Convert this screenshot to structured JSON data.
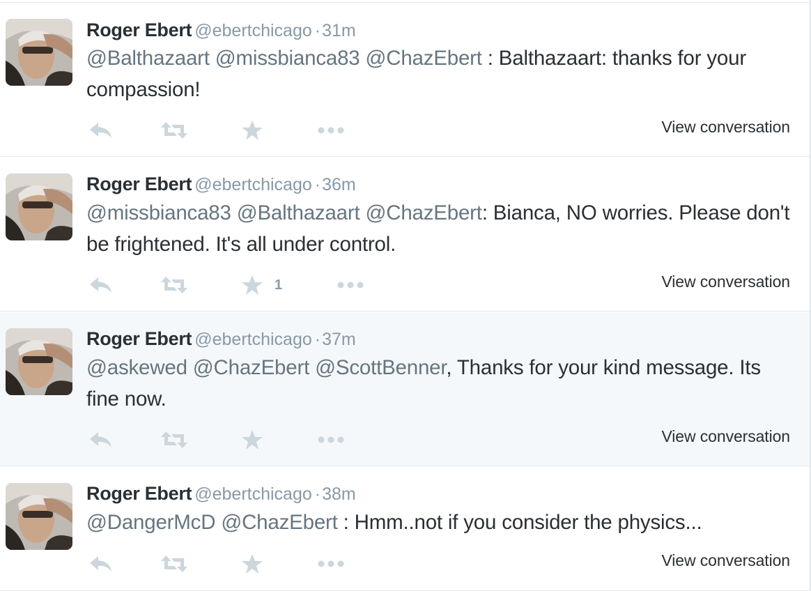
{
  "actions_labels": {
    "view_conversation": "View conversation"
  },
  "tweets": [
    {
      "fullname": "Roger Ebert",
      "username": "@ebertchicago",
      "dot": "·",
      "time": "31m",
      "mentions": "@Balthazaart @missbianca83 @ChazEbert",
      "text_rest": " : Balthazaart: thanks for your compassion!",
      "favorite_count": "",
      "view_conversation": "View conversation"
    },
    {
      "fullname": "Roger Ebert",
      "username": "@ebertchicago",
      "dot": "·",
      "time": "36m",
      "mentions": "@missbianca83 @Balthazaart @ChazEbert",
      "text_rest": ": Bianca, NO worries. Please don't be frightened. It's all under control.",
      "favorite_count": "1",
      "view_conversation": "View conversation"
    },
    {
      "fullname": "Roger Ebert",
      "username": "@ebertchicago",
      "dot": "·",
      "time": "37m",
      "mentions": "@askewed @ChazEbert @ScottBenner",
      "text_rest": ", Thanks for your kind message. Its fine now.",
      "favorite_count": "",
      "view_conversation": "View conversation"
    },
    {
      "fullname": "Roger Ebert",
      "username": "@ebertchicago",
      "dot": "·",
      "time": "38m",
      "mentions": "@DangerMcD @ChazEbert",
      "text_rest": " : Hmm..not if you consider the physics...",
      "favorite_count": "",
      "view_conversation": "View conversation"
    }
  ],
  "colors": {
    "mention": "#66757f",
    "meta": "#8899a6",
    "icon": "#ccd6dd",
    "hover_background": "#f5f8fa",
    "divider": "#e1e8ed"
  },
  "icons": {
    "reply": "reply-icon",
    "retweet": "retweet-icon",
    "favorite": "star-icon",
    "more": "more-dots-icon"
  }
}
